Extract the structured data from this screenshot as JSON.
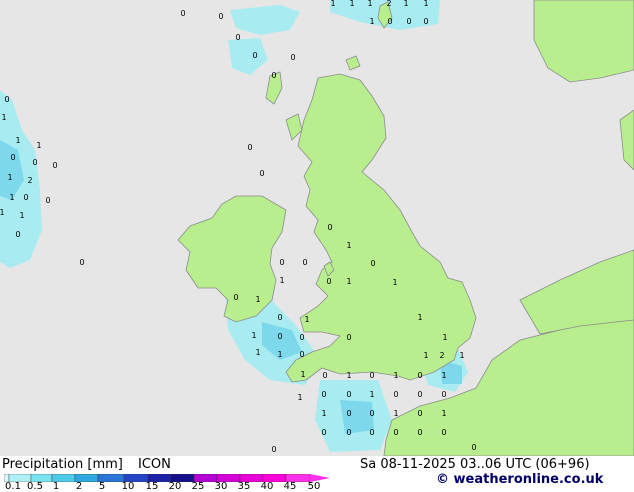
{
  "title": {
    "label": "Precipitation [mm]",
    "model": "ICON",
    "datetime": "Sa 08-11-2025 03..06 UTC (06+96)",
    "credit": "© weatheronline.co.uk"
  },
  "colors": {
    "sea": "#e6e6e6",
    "land": "#b8ee8e",
    "coast": "#8c8c8c",
    "precip_light": "#a8ecf2",
    "precip_medium": "#7dd8ec",
    "credit": "#000066"
  },
  "legend": {
    "ticks": [
      "0.1",
      "0.5",
      "1",
      "2",
      "5",
      "10",
      "15",
      "20",
      "25",
      "30",
      "35",
      "40",
      "45",
      "50"
    ],
    "colors": [
      "#dcf7fa",
      "#aef0f6",
      "#78e3ef",
      "#4fc9e8",
      "#2fa7e0",
      "#2a74d6",
      "#2344c4",
      "#1c22a8",
      "#14118a",
      "#b400d4",
      "#d400d8",
      "#e800d8",
      "#ff00dc",
      "#ff30ec"
    ]
  },
  "station_values": [
    "1",
    "1",
    "1",
    "2",
    "1",
    "1",
    "0",
    "0",
    "1",
    "0",
    "0",
    "0",
    "0",
    "0",
    "0",
    "0",
    "0",
    "1",
    "1",
    "1",
    "0",
    "0",
    "0",
    "1",
    "2",
    "1",
    "0",
    "0",
    "1",
    "1",
    "0",
    "0",
    "1",
    "0",
    "0",
    "0",
    "0",
    "1",
    "0",
    "1",
    "1",
    "0",
    "1",
    "0",
    "1",
    "1",
    "0",
    "0",
    "1",
    "1",
    "0",
    "0",
    "1",
    "1",
    "1",
    "2",
    "1",
    "1",
    "0",
    "1",
    "0",
    "1",
    "0",
    "1",
    "0",
    "0",
    "1",
    "0",
    "0",
    "0",
    "1",
    "0",
    "0",
    "1",
    "0",
    "1",
    "0",
    "0",
    "0",
    "0",
    "0",
    "0",
    "0",
    "0",
    "1",
    "0",
    "0"
  ]
}
